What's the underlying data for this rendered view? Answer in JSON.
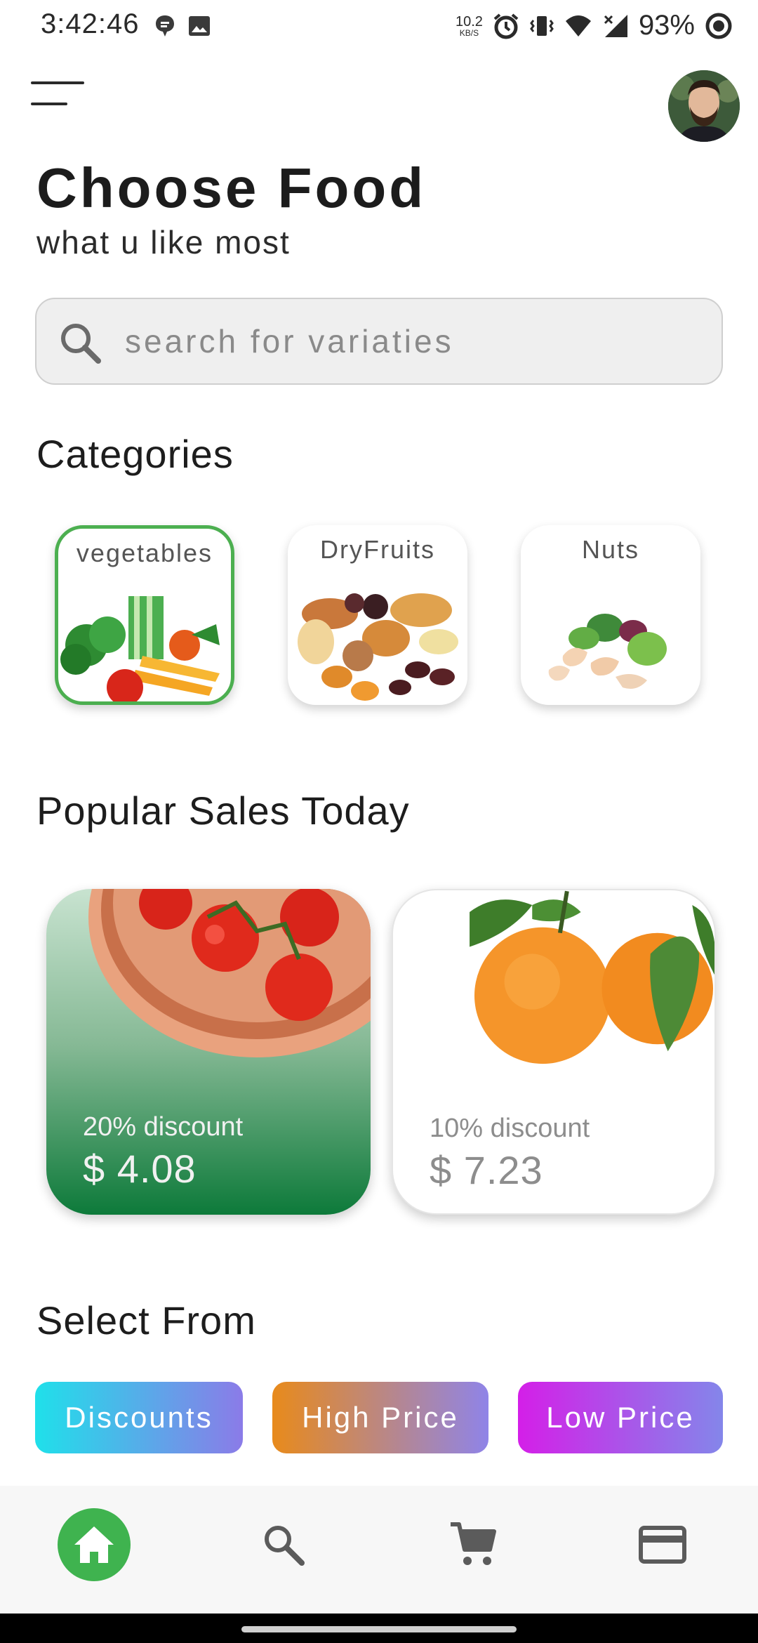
{
  "status_bar": {
    "time": "3:42:46",
    "net_speed": "10.2",
    "net_unit": "KB/S",
    "battery": "93%"
  },
  "header": {
    "title": "Choose Food",
    "subtitle": "what u like most"
  },
  "search": {
    "placeholder": "search for variaties",
    "icon": "search-icon"
  },
  "categories": {
    "title": "Categories",
    "items": [
      {
        "label": "vegetables",
        "selected": true
      },
      {
        "label": "DryFruits",
        "selected": false
      },
      {
        "label": "Nuts",
        "selected": false
      }
    ]
  },
  "popular": {
    "title": "Popular Sales Today",
    "items": [
      {
        "discount": "20% discount",
        "price": "$ 4.08"
      },
      {
        "discount": "10% discount",
        "price": "$ 7.23"
      }
    ]
  },
  "select_from": {
    "title": "Select From",
    "buttons": [
      "Discounts",
      "High Price",
      "Low Price"
    ]
  },
  "bottom_nav": {
    "items": [
      "home-icon",
      "search-icon",
      "cart-icon",
      "credit-card-icon"
    ],
    "active": "home-icon",
    "accent": "#3fb34f"
  }
}
